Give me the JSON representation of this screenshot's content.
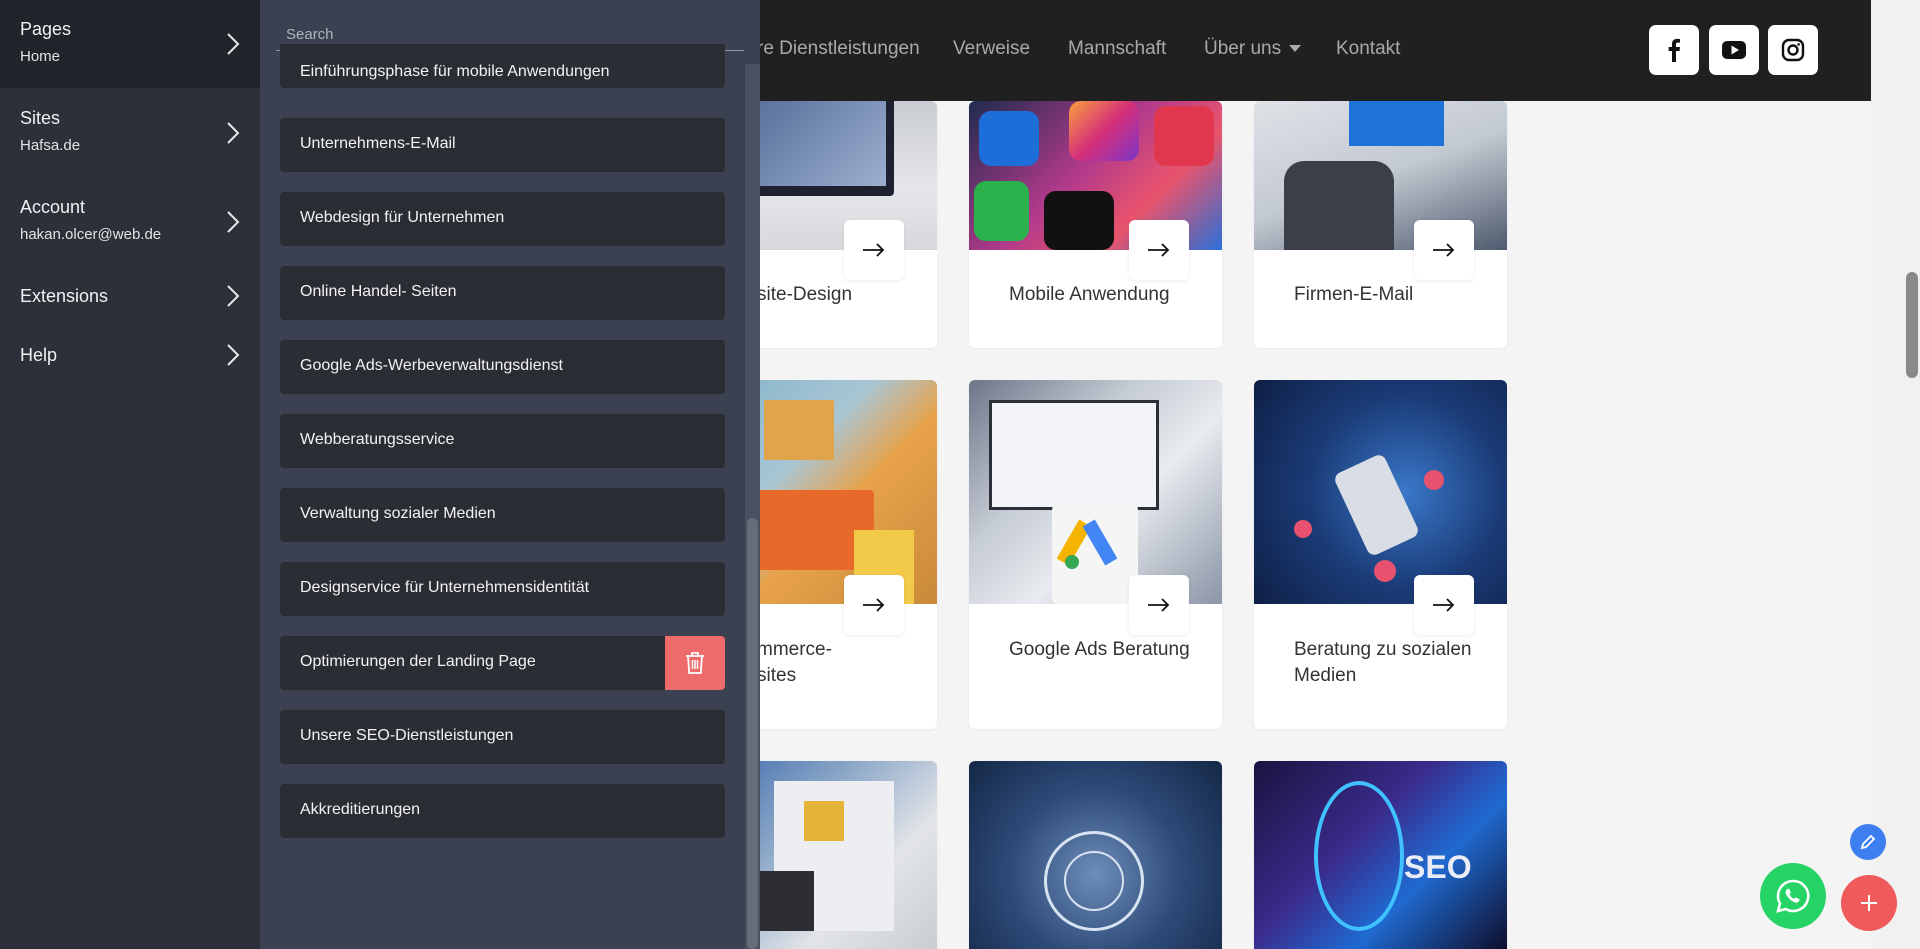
{
  "site": {
    "nav": {
      "items": [
        "re Dienstleistungen",
        "Verweise",
        "Mannschaft",
        "Über uns",
        "Kontakt"
      ]
    },
    "social": [
      "facebook-icon",
      "youtube-icon",
      "instagram-icon"
    ],
    "cards": [
      {
        "title": "site-Design"
      },
      {
        "title": "Mobile Anwendung"
      },
      {
        "title": "Firmen-E-Mail"
      },
      {
        "title_line1": "mmerce-",
        "title_line2": "sites"
      },
      {
        "title": "Google Ads Beratung"
      },
      {
        "title_line1": "Beratung zu sozialen",
        "title_line2": "Medien"
      }
    ]
  },
  "sidebar": {
    "items": [
      {
        "title": "Pages",
        "sub": "Home"
      },
      {
        "title": "Sites",
        "sub": "Hafsa.de"
      },
      {
        "title": "Account",
        "sub": "hakan.olcer@web.de"
      },
      {
        "title": "Extensions"
      },
      {
        "title": "Help"
      }
    ]
  },
  "pages_panel": {
    "search_placeholder": "Search",
    "items": [
      "Einführungsphase für mobile Anwendungen",
      "Unternehmens-E-Mail",
      "Webdesign für Unternehmen",
      "Online Handel- Seiten",
      "Google Ads-Werbeverwaltungsdienst",
      "Webberatungsservice",
      "Verwaltung sozialer Medien",
      "Designservice für Unternehmensidentität",
      "Optimierungen der Landing Page",
      "Unsere SEO-Dienstleistungen",
      "Akkreditierungen"
    ]
  },
  "colors": {
    "delete": "#ee6b6b",
    "whatsapp": "#25d366",
    "add_fab": "#f05a5a",
    "edit_fab": "#3d7ef0"
  }
}
